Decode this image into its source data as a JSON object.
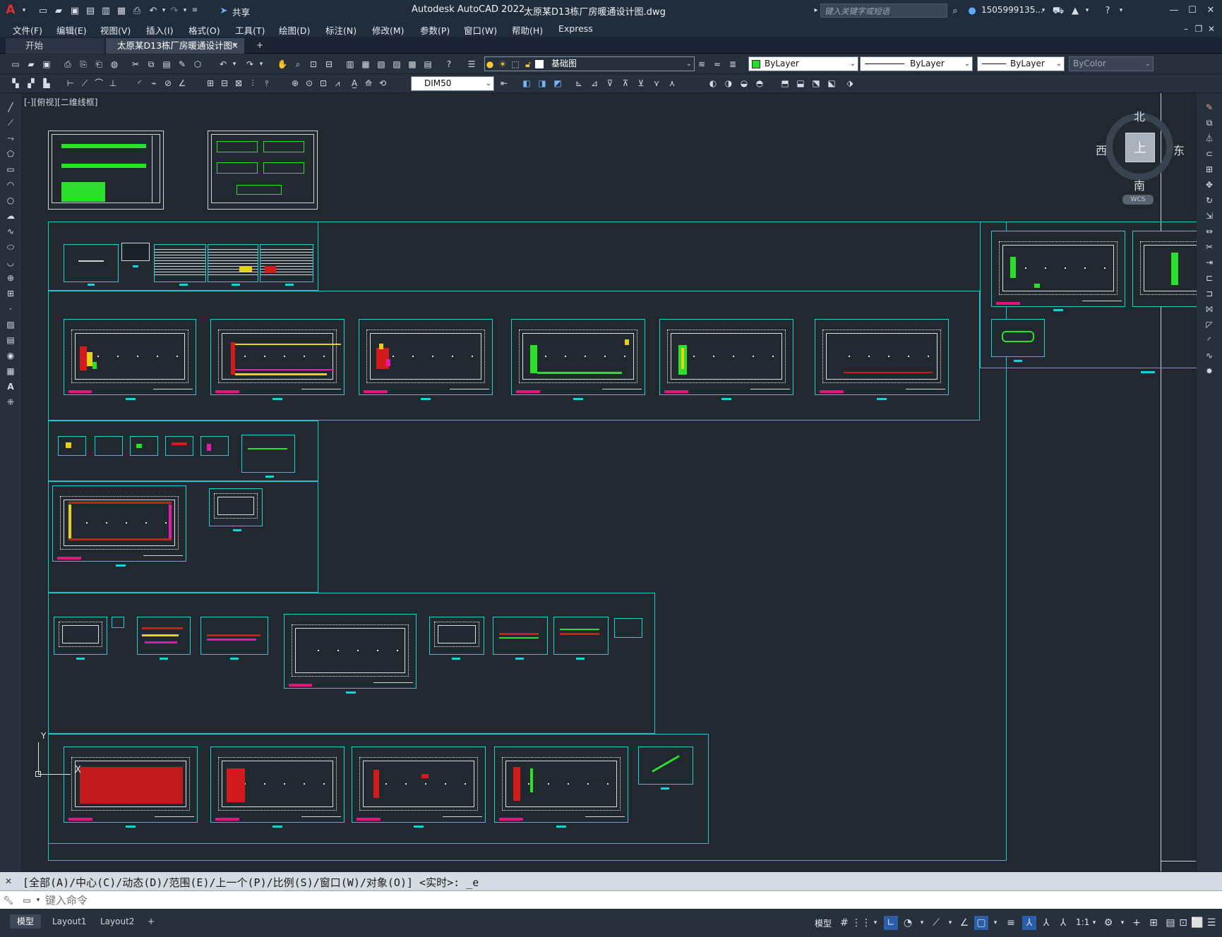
{
  "titlebar": {
    "app_title": "Autodesk AutoCAD 2022",
    "file_title": "太原某D13栋厂房暖通设计图.dwg",
    "share_label": "共享",
    "search_placeholder": "键入关键字或短语",
    "user": "1505999135..."
  },
  "menu": [
    "文件(F)",
    "编辑(E)",
    "视图(V)",
    "插入(I)",
    "格式(O)",
    "工具(T)",
    "绘图(D)",
    "标注(N)",
    "修改(M)",
    "参数(P)",
    "窗口(W)",
    "帮助(H)",
    "Express"
  ],
  "tabs": {
    "start": "开始",
    "active": "太原某D13栋厂房暖通设计图*"
  },
  "toolbar1": {
    "layer": "基础图",
    "color": "ByLayer",
    "linetype": "ByLayer",
    "lineweight": "ByLayer",
    "plotstyle": "ByColor",
    "layer_color": "#22dd22"
  },
  "toolbar2": {
    "dimstyle": "DIM50"
  },
  "viewport": {
    "label": "[-][俯视][二维线框]"
  },
  "viewcube": {
    "north": "北",
    "south": "南",
    "east": "东",
    "west": "西",
    "face": "上",
    "wcs": "WCS"
  },
  "ucs": {
    "x": "X",
    "y": "Y"
  },
  "command": {
    "history": "[全部(A)/中心(C)/动态(D)/范围(E)/上一个(P)/比例(S)/窗口(W)/对象(O)] <实时>: _e",
    "placeholder": "键入命令"
  },
  "layouts": {
    "model": "模型",
    "layout1": "Layout1",
    "layout2": "Layout2"
  },
  "status": {
    "model": "模型",
    "scale": "1:1"
  },
  "colors": {
    "canvas": "#212830",
    "frame": "#19c6cc",
    "accent": "#2b5ea8"
  }
}
